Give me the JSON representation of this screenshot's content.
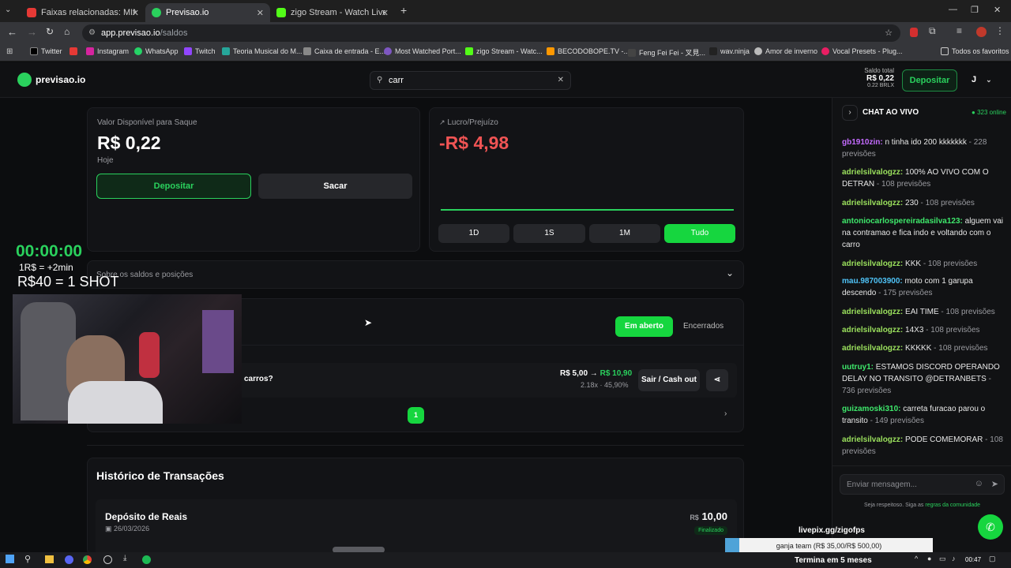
{
  "browser": {
    "tabs": [
      {
        "title": "Faixas relacionadas: MINA PERVE",
        "color": "#e53935"
      },
      {
        "title": "Previsao.io",
        "color": "#2ad15d"
      },
      {
        "title": "zigo Stream - Watch Live on Ki",
        "color": "#53fc18"
      }
    ],
    "url_domain": "app.previsao.io",
    "url_path": "/saldos",
    "bookmarks": [
      "Twitter",
      "Instagram",
      "WhatsApp",
      "Twitch",
      "Teoria Musical do M...",
      "Caixa de entrada - E...",
      "Most Watched Port...",
      "zigo Stream - Watc...",
      "BECODOBOPE.TV -...",
      "Feng Fei Fei - 叉見...",
      "wav.ninja",
      "Amor de inverno",
      "Vocal Presets - Plug..."
    ],
    "all_favorites": "Todos os favoritos"
  },
  "header": {
    "logo": "previsao.io",
    "search_value": "carr",
    "saldo_label": "Saldo total",
    "saldo_value": "R$ 0,22",
    "saldo_sub": "0.22 BRLX",
    "deposit": "Depositar",
    "user_initial": "J"
  },
  "balance": {
    "label": "Valor Disponível para Saque",
    "value": "R$ 0,22",
    "sub": "Hoje",
    "deposit": "Depositar",
    "withdraw": "Sacar"
  },
  "pnl": {
    "label": "Lucro/Prejuízo",
    "value": "-R$ 4,98",
    "ranges": [
      "1D",
      "1S",
      "1M",
      "Tudo"
    ],
    "active_range": "Tudo"
  },
  "about": {
    "label": "Sobre os saldos e posições"
  },
  "positions": {
    "tab_open": "Em aberto",
    "tab_closed": "Encerrados",
    "row_question": "carros?",
    "row_values": "R$ 5,00 → R$ 10,90",
    "row_from": "R$ 5,00 →",
    "row_to": "R$ 10,90",
    "row_sub": "2.18x · 45,90%",
    "cashout": "Sair / Cash out",
    "page": "1"
  },
  "history": {
    "title": "Histórico de Transações",
    "item_title": "Depósito de Reais",
    "item_date": "26/03/2026",
    "item_currency": "R$",
    "item_amount": "10,00",
    "item_status": "Finalizado"
  },
  "overlay": {
    "timer": "00:00:00",
    "rate": "1R$ = +2min",
    "shot": "R$40 = 1 SHOT",
    "livepix": "livepix.gg/zigofps",
    "goal": "ganja team (R$ 35,00/R$ 500,00)",
    "goal_progress": 0.07,
    "ends": "Termina em 5 meses"
  },
  "chat": {
    "title": "CHAT AO VIVO",
    "online": "323 online",
    "messages": [
      {
        "user": "gb1910zin:",
        "color": "#c46bff",
        "text": "n tinha ido 200 kkkkkkk",
        "pred": " - 228 previsões"
      },
      {
        "user": "adrielsilvalogzz:",
        "color": "#9be15d",
        "text": "100% AO VIVO COM O DETRAN",
        "pred": " - 108 previsões"
      },
      {
        "user": "adrielsilvalogzz:",
        "color": "#9be15d",
        "text": "230",
        "pred": " - 108 previsões"
      },
      {
        "user": "antoniocarlospereiradasilva123:",
        "color": "#3ee86b",
        "text": "alguem vai na contramao e fica indo e voltando com o carro",
        "pred": ""
      },
      {
        "user": "adrielsilvalogzz:",
        "color": "#9be15d",
        "text": "KKK",
        "pred": " - 108 previsões"
      },
      {
        "user": "mau.987003900:",
        "color": "#4fc3f7",
        "text": "moto com 1 garupa descendo",
        "pred": " - 175 previsões"
      },
      {
        "user": "adrielsilvalogzz:",
        "color": "#9be15d",
        "text": "EAI TIME",
        "pred": " - 108 previsões"
      },
      {
        "user": "adrielsilvalogzz:",
        "color": "#9be15d",
        "text": "14X3",
        "pred": " - 108 previsões"
      },
      {
        "user": "adrielsilvalogzz:",
        "color": "#9be15d",
        "text": "KKKKK",
        "pred": " - 108 previsões"
      },
      {
        "user": "uutruy1:",
        "color": "#3ee86b",
        "text": "ESTAMOS DISCORD OPERANDO DELAY NO TRANSITO @DETRANBETS",
        "pred": " - 736 previsões"
      },
      {
        "user": "guizamoski310:",
        "color": "#3ee86b",
        "text": "carreta furacao parou o transito",
        "pred": " - 149 previsões"
      },
      {
        "user": "adrielsilvalogzz:",
        "color": "#9be15d",
        "text": "PODE COMEMORAR",
        "pred": " - 108 previsões"
      }
    ],
    "input_placeholder": "Enviar mensagem...",
    "rules_prefix": "Seja respeitoso. Siga as",
    "rules_link": "regras da comunidade"
  },
  "taskbar": {
    "time": "00:47"
  }
}
